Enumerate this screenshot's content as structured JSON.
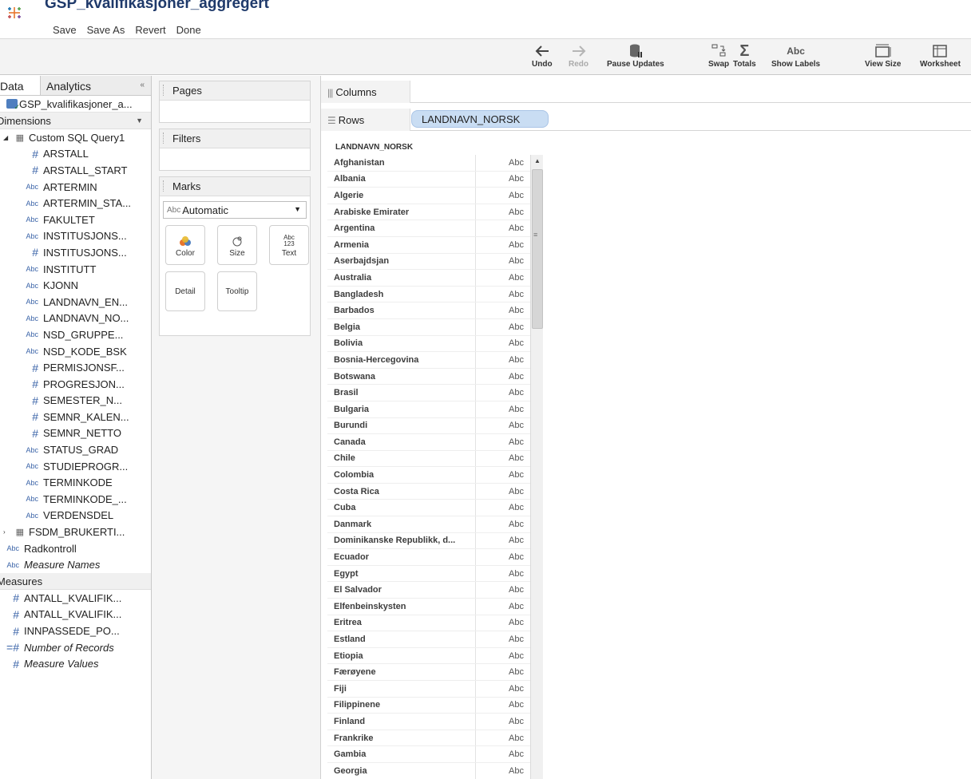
{
  "window": {
    "title": "GSP_kvalifikasjoner_aggregert",
    "menu": [
      "Save",
      "Save As",
      "Revert",
      "Done"
    ]
  },
  "toolbar": {
    "undo": "Undo",
    "redo": "Redo",
    "pause_updates": "Pause Updates",
    "swap": "Swap",
    "totals": "Totals",
    "show_labels": "Show Labels",
    "show_labels_icon_text": "Abc",
    "view_size": "View Size",
    "worksheet": "Worksheet"
  },
  "data_pane": {
    "tabs": [
      "Data",
      "Analytics"
    ],
    "collapse_glyph": "«",
    "datasource": "GSP_kvalifikasjoner_a...",
    "dimensions_label": "Dimensions",
    "table1": "Custom SQL Query1",
    "dimension_fields": [
      {
        "type": "#",
        "name": "ARSTALL"
      },
      {
        "type": "#",
        "name": "ARSTALL_START"
      },
      {
        "type": "Abc",
        "name": "ARTERMIN"
      },
      {
        "type": "Abc",
        "name": "ARTERMIN_STA..."
      },
      {
        "type": "Abc",
        "name": "FAKULTET"
      },
      {
        "type": "Abc",
        "name": "INSTITUSJONS..."
      },
      {
        "type": "#",
        "name": "INSTITUSJONS..."
      },
      {
        "type": "Abc",
        "name": "INSTITUTT"
      },
      {
        "type": "Abc",
        "name": "KJONN"
      },
      {
        "type": "Abc",
        "name": "LANDNAVN_EN..."
      },
      {
        "type": "Abc",
        "name": "LANDNAVN_NO..."
      },
      {
        "type": "Abc",
        "name": "NSD_GRUPPE..."
      },
      {
        "type": "Abc",
        "name": "NSD_KODE_BSK"
      },
      {
        "type": "#",
        "name": "PERMISJONSF..."
      },
      {
        "type": "#",
        "name": "PROGRESJON..."
      },
      {
        "type": "#",
        "name": "SEMESTER_N..."
      },
      {
        "type": "#",
        "name": "SEMNR_KALEN..."
      },
      {
        "type": "#",
        "name": "SEMNR_NETTO"
      },
      {
        "type": "Abc",
        "name": "STATUS_GRAD"
      },
      {
        "type": "Abc",
        "name": "STUDIEPROGR..."
      },
      {
        "type": "Abc",
        "name": "TERMINKODE"
      },
      {
        "type": "Abc",
        "name": "TERMINKODE_..."
      },
      {
        "type": "Abc",
        "name": "VERDENSDEL"
      }
    ],
    "table2": "FSDM_BRUKERTI...",
    "extra_dimensions": [
      {
        "type": "Abc",
        "name": "Radkontroll",
        "italic": false
      },
      {
        "type": "Abc",
        "name": "Measure Names",
        "italic": true
      }
    ],
    "measures_label": "Measures",
    "measure_fields": [
      {
        "type": "#",
        "name": "ANTALL_KVALIFIK...",
        "italic": false
      },
      {
        "type": "#",
        "name": "ANTALL_KVALIFIK...",
        "italic": false
      },
      {
        "type": "#",
        "name": "INNPASSEDE_PO...",
        "italic": false
      },
      {
        "type": "=#",
        "name": "Number of Records",
        "italic": true
      },
      {
        "type": "#",
        "name": "Measure Values",
        "italic": true
      }
    ]
  },
  "shelves": {
    "pages": "Pages",
    "filters": "Filters",
    "marks": "Marks",
    "mark_type_prefix": "Abc",
    "mark_type": "Automatic",
    "mark_buttons": {
      "color": "Color",
      "size": "Size",
      "text": "Text",
      "detail": "Detail",
      "tooltip": "Tooltip",
      "text_icon_top": "Abc",
      "text_icon_bottom": "123"
    },
    "columns": "Columns",
    "rows": "Rows",
    "rows_pill": "LANDNAVN_NORSK"
  },
  "view": {
    "header": "LANDNAVN_NORSK",
    "cell_value": "Abc",
    "rows": [
      "Afghanistan",
      "Albania",
      "Algerie",
      "Arabiske Emirater",
      "Argentina",
      "Armenia",
      "Aserbajdsjan",
      "Australia",
      "Bangladesh",
      "Barbados",
      "Belgia",
      "Bolivia",
      "Bosnia-Hercegovina",
      "Botswana",
      "Brasil",
      "Bulgaria",
      "Burundi",
      "Canada",
      "Chile",
      "Colombia",
      "Costa Rica",
      "Cuba",
      "Danmark",
      "Dominikanske Republikk, d...",
      "Ecuador",
      "Egypt",
      "El Salvador",
      "Elfenbeinskysten",
      "Eritrea",
      "Estland",
      "Etiopia",
      "Færøyene",
      "Fiji",
      "Filippinene",
      "Finland",
      "Frankrike",
      "Gambia",
      "Georgia"
    ]
  }
}
